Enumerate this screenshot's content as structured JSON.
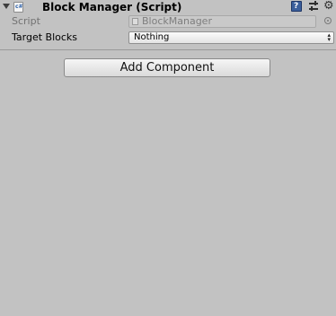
{
  "component": {
    "title": "Block Manager (Script)",
    "icon": "script-icon",
    "script_icon_glyph": "c#",
    "help_glyph": "?"
  },
  "fields": {
    "script": {
      "label": "Script",
      "value": "BlockManager"
    },
    "target_blocks": {
      "label": "Target Blocks",
      "value": "Nothing"
    }
  },
  "add_component_label": "Add Component",
  "colors": {
    "background": "#c2c2c2",
    "disabled_text": "#727272",
    "help_icon": "#3b5f9b"
  }
}
